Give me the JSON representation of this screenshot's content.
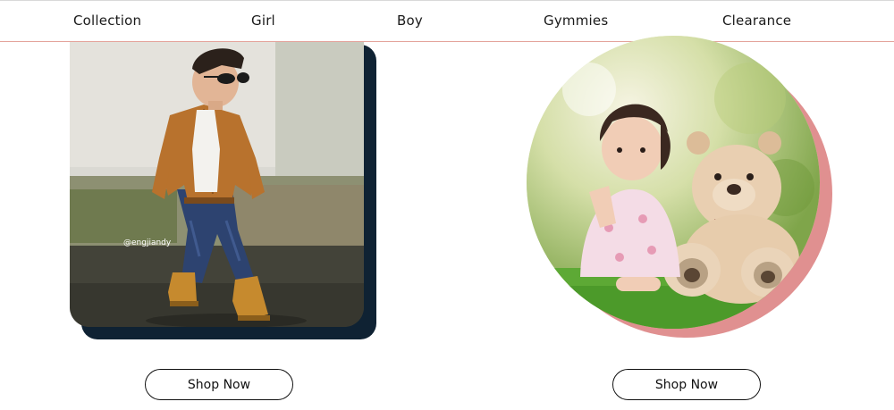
{
  "nav": {
    "items": [
      {
        "label": "Collection"
      },
      {
        "label": "Girl"
      },
      {
        "label": "Boy"
      },
      {
        "label": "Gymmies"
      },
      {
        "label": "Clearance"
      }
    ]
  },
  "cards": {
    "left": {
      "photo_watermark": "@engjiandy",
      "button_label": "Shop Now"
    },
    "right": {
      "button_label": "Shop Now"
    }
  },
  "colors": {
    "nav_divider": "#e4a49c",
    "left_shadow": "#0f2233",
    "right_ring": "#e09090"
  }
}
